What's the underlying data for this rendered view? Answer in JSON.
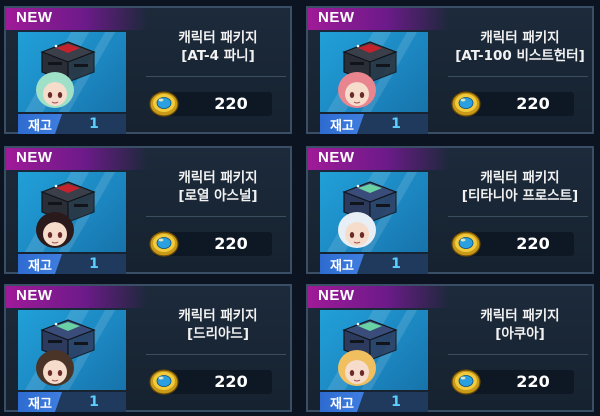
{
  "new_label": "NEW",
  "stock_label": "재고",
  "cards": [
    {
      "title": "캐릭터 패키지",
      "subtitle": "[AT-4 파니]",
      "price": "220",
      "stock": "1",
      "crate": "red",
      "hair": "#9fe0c8"
    },
    {
      "title": "캐릭터 패키지",
      "subtitle": "[AT-100 비스트헌터]",
      "price": "220",
      "stock": "1",
      "crate": "red",
      "hair": "#e9858f"
    },
    {
      "title": "캐릭터 패키지",
      "subtitle": "[로열 아스널]",
      "price": "220",
      "stock": "1",
      "crate": "red",
      "hair": "#2a1a1c"
    },
    {
      "title": "캐릭터 패키지",
      "subtitle": "[티타니아 프로스트]",
      "price": "220",
      "stock": "1",
      "crate": "blue",
      "hair": "#e8eef5"
    },
    {
      "title": "캐릭터 패키지",
      "subtitle": "[드리아드]",
      "price": "220",
      "stock": "1",
      "crate": "blue",
      "hair": "#4a3428"
    },
    {
      "title": "캐릭터 패키지",
      "subtitle": "[아쿠아]",
      "price": "220",
      "stock": "1",
      "crate": "blue",
      "hair": "#f0c060"
    }
  ]
}
